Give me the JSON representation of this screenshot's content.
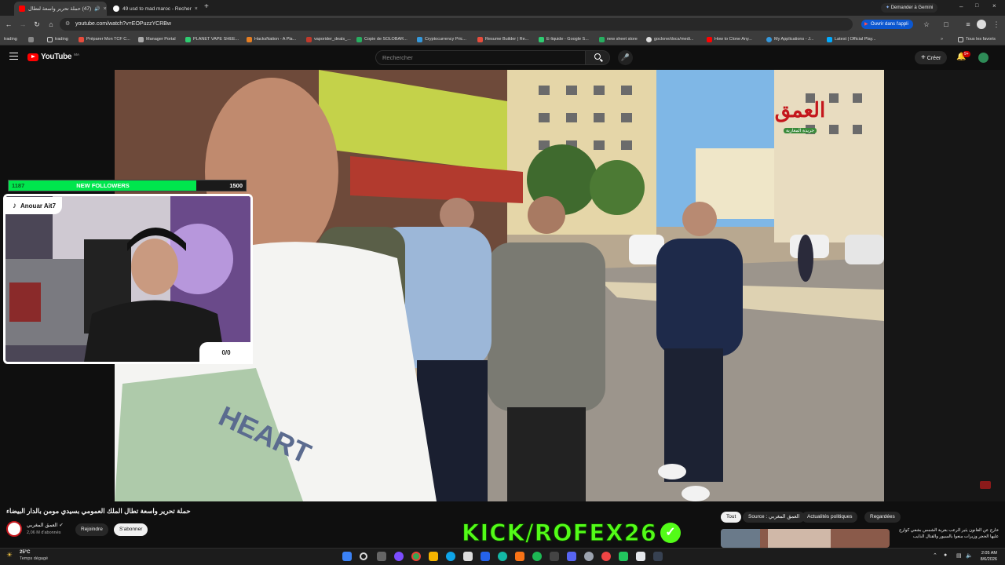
{
  "tabs": [
    {
      "label": "(47) حملة تحرير واسعة لتطال",
      "active": true,
      "badge": "YT"
    },
    {
      "label": "49 usd to mad maroc - Recher",
      "active": false
    }
  ],
  "gemini_label": "Demander à Gemini",
  "url": "youtube.com/watch?v=EOPuzzYCRBw",
  "open_app_label": "Ouvrir dans l'appli",
  "bookmarks": [
    {
      "label": "trading"
    },
    {
      "label": "trading"
    },
    {
      "label": "Préparer Mon TCF C..."
    },
    {
      "label": "Manager Portal"
    },
    {
      "label": "PLANET VAPE SHEE..."
    },
    {
      "label": "HacksNation - A Pla..."
    },
    {
      "label": "vaporider_deals_..."
    },
    {
      "label": "Copie de SOLOBAR..."
    },
    {
      "label": "Cryptocurrency Pric..."
    },
    {
      "label": "Resume Builder | Re..."
    },
    {
      "label": "E-liquide - Google S..."
    },
    {
      "label": "new sheet store"
    },
    {
      "label": "goclone/docs/medi..."
    },
    {
      "label": "How to Clone Any..."
    },
    {
      "label": "My Applications - J..."
    },
    {
      "label": "Latest | Official Play..."
    },
    {
      "label": "Tous les favoris"
    }
  ],
  "youtube": {
    "logo_text": "YouTube",
    "region": "MA",
    "search_placeholder": "Rechercher",
    "create_label": "Créer",
    "notif_count": "9+"
  },
  "video": {
    "channel_watermark": "العمق",
    "channel_watermark_sub": "جريدة المغاربة"
  },
  "overlay": {
    "followers_current": "1187",
    "followers_label": "NEW FOLLOWERS",
    "followers_goal": "1500",
    "streamer_name": "Anouar Ait7",
    "counter": "0/0"
  },
  "video_title": "حملة تحرير واسعة تطال الملك العمومي بسيدي مومن بالدار البيضاء",
  "channel": {
    "name": "العمق المغربي",
    "subscribers": "2,06 M d'abonnés",
    "join_label": "Rejoindre",
    "subscribe_label": "S'abonner"
  },
  "kick_banner": "KICK/ROFEX26",
  "filter_chips": [
    {
      "label": "Tout",
      "active": true
    },
    {
      "label": "Source : العمق المغربي",
      "active": false
    },
    {
      "label": "Actualités politiques",
      "active": false
    },
    {
      "label": "Regardées",
      "active": false
    }
  ],
  "suggested": {
    "title": "خارج عن القانون يثير الرعب بقرية الشمس بشفي كوارح عليها الحجر وزيرات منعوا بالسيور والقتال الذايب"
  },
  "taskbar": {
    "weather_temp": "25°C",
    "weather_desc": "Temps dégagé",
    "time": "2:05 AM",
    "date": "8/6/2026"
  },
  "colors": {
    "youtube_red": "#ff0000",
    "kick_green": "#53fc18",
    "followers_green": "#00e64d",
    "chrome_blue": "#0b57d0"
  }
}
